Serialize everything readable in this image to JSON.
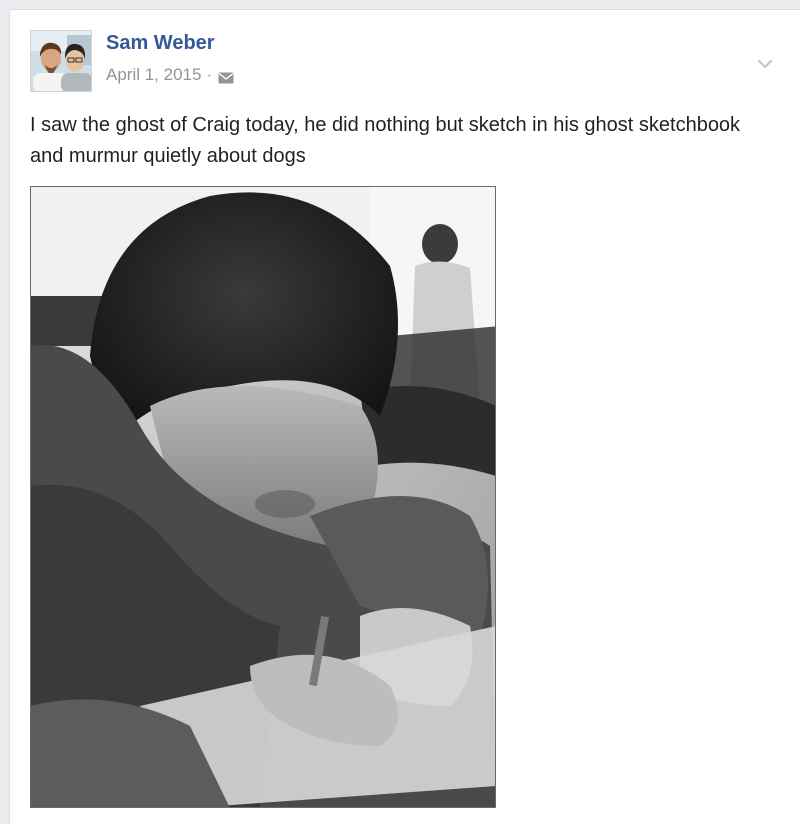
{
  "post": {
    "author_name": "Sam Weber",
    "date": "April 1, 2015",
    "separator": "·",
    "audience_icon": "envelope-icon",
    "menu_icon": "chevron-down-icon",
    "text": "I saw the ghost of Craig today, he did nothing but sketch in his ghost sketchbook and murmur quietly about dogs",
    "photo_description": "grayscale-photo-person-sketching"
  },
  "colors": {
    "background": "#e9ebee",
    "card": "#ffffff",
    "author_link": "#365899",
    "meta_text": "#90949c",
    "body_text": "#1d2129"
  }
}
